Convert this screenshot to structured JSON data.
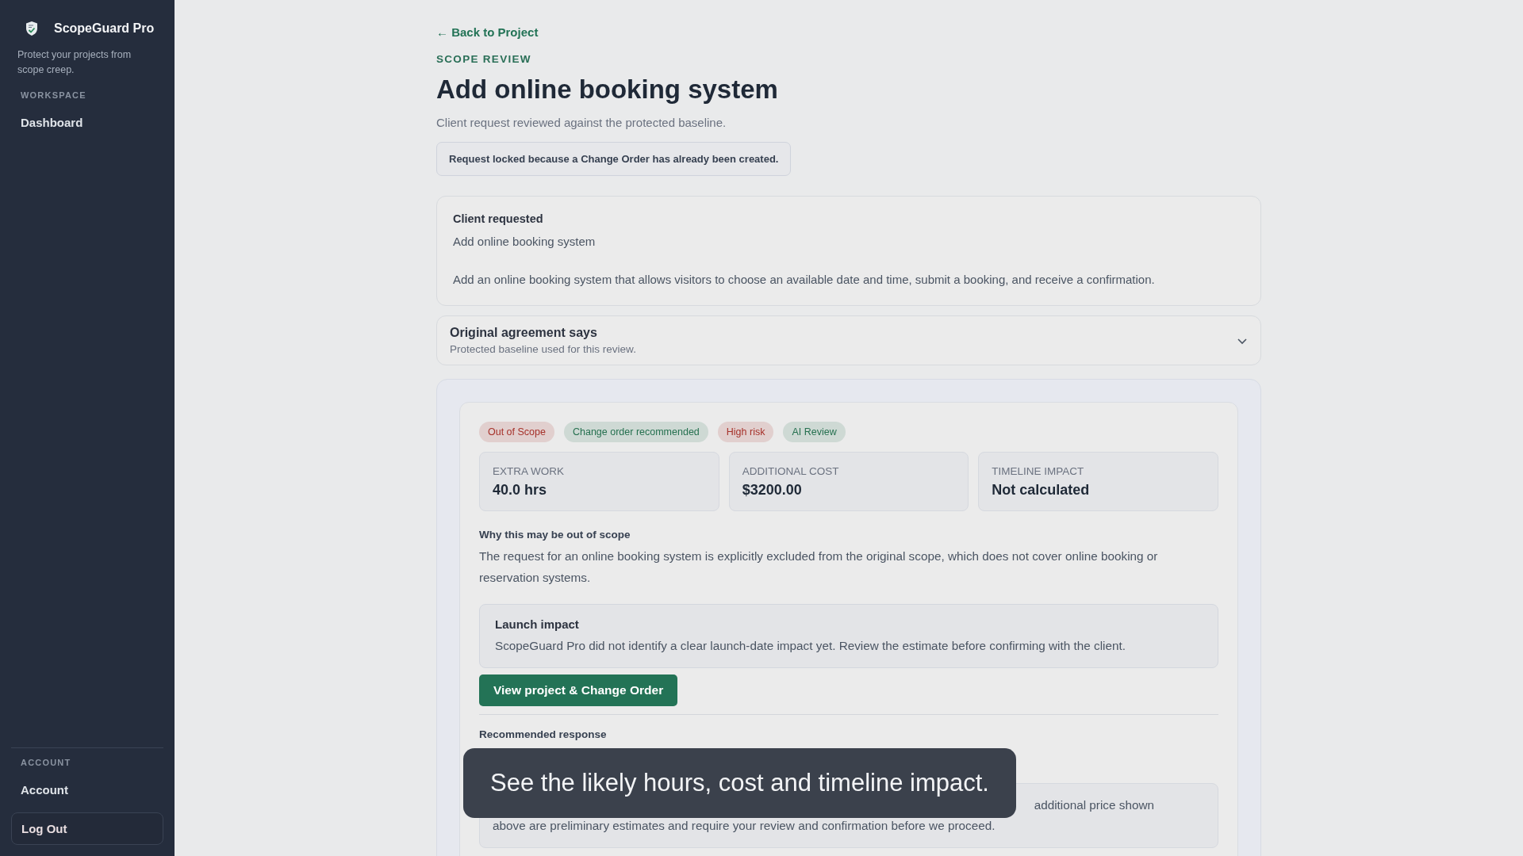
{
  "sidebar": {
    "brand": "ScopeGuard Pro",
    "tagline": "Protect your projects from scope creep.",
    "sections": [
      {
        "heading": "WORKSPACE",
        "items": [
          {
            "label": "Dashboard",
            "kind": "link"
          }
        ]
      },
      {
        "heading": "ACCOUNT",
        "items": [
          {
            "label": "Account",
            "kind": "link"
          },
          {
            "label": "Log Out",
            "kind": "button"
          }
        ]
      }
    ]
  },
  "back_link": "← Back to Project",
  "eyebrow": "SCOPE REVIEW",
  "title": "Add online booking system",
  "subtitle": "Client request reviewed against the protected baseline.",
  "lock_notice": "Request locked because a Change Order has already been created.",
  "client_request": {
    "heading": "Client requested",
    "title": "Add online booking system",
    "description": "Add an online booking system that allows visitors to choose an available date and time, submit a booking, and receive a confirmation."
  },
  "agreement": {
    "heading": "Original agreement says",
    "subtitle": "Protected baseline used for this review.",
    "expanded": false
  },
  "review": {
    "badges": [
      {
        "label": "Out of Scope",
        "color": "#a6312a"
      },
      {
        "label": "Change order recommended",
        "color": "#25704f"
      },
      {
        "label": "High risk",
        "color": "#a6312a"
      },
      {
        "label": "AI Review",
        "color": "#25704f"
      }
    ],
    "metrics": [
      {
        "label": "EXTRA WORK",
        "value": "40.0 hrs"
      },
      {
        "label": "ADDITIONAL COST",
        "value": "$3200.00"
      },
      {
        "label": "TIMELINE IMPACT",
        "value": "Not calculated"
      }
    ],
    "why_heading": "Why this may be out of scope",
    "why_text": "The request for an online booking system is explicitly excluded from the original scope, which does not cover online booking or reservation systems.",
    "launch": {
      "heading": "Launch impact",
      "text": "ScopeGuard Pro did not identify a clear launch-date impact yet. Review the estimate before confirming with the client."
    },
    "action_button": "View project & Change Order",
    "response_heading": "Recommended response",
    "response_lines": [
      "additional price shown",
      "above are preliminary estimates and require your review and confirmation before we proceed."
    ]
  },
  "caption": "See the likely hours, cost and timeline impact."
}
